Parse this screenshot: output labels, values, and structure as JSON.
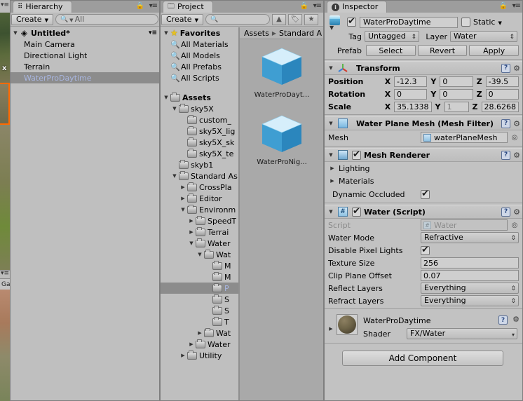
{
  "scene_sliver": {
    "tab_label": "Ga",
    "gizmo_label": "x"
  },
  "hierarchy": {
    "tab": "Hierarchy",
    "tab_icon": "hierarchy-icon",
    "create_label": "Create",
    "search_placeholder": "All",
    "scene_name": "Untitled*",
    "items": [
      {
        "label": "Main Camera",
        "selected": false
      },
      {
        "label": "Directional Light",
        "selected": false
      },
      {
        "label": "Terrain",
        "selected": false
      },
      {
        "label": "WaterProDaytime",
        "selected": true
      }
    ]
  },
  "project": {
    "tab": "Project",
    "tab_icon": "folder-icon",
    "create_label": "Create",
    "search_placeholder": "",
    "toolbar_icons": [
      "filter-by-type-icon",
      "filter-by-label-icon",
      "favorite-star-icon"
    ],
    "breadcrumb": [
      "Assets",
      "Standard A"
    ],
    "favorites_label": "Favorites",
    "favorites": [
      "All Materials",
      "All Models",
      "All Prefabs",
      "All Scripts"
    ],
    "tree": [
      {
        "label": "Assets",
        "depth": 0,
        "arrow": "down",
        "bold": true,
        "selected": false
      },
      {
        "label": "sky5X",
        "depth": 1,
        "arrow": "down",
        "bold": false,
        "selected": false
      },
      {
        "label": "custom_",
        "depth": 2,
        "arrow": "none",
        "bold": false,
        "selected": false
      },
      {
        "label": "sky5X_lig",
        "depth": 2,
        "arrow": "none",
        "bold": false,
        "selected": false
      },
      {
        "label": "sky5X_sk",
        "depth": 2,
        "arrow": "none",
        "bold": false,
        "selected": false
      },
      {
        "label": "sky5X_te",
        "depth": 2,
        "arrow": "none",
        "bold": false,
        "selected": false
      },
      {
        "label": "skyb1",
        "depth": 1,
        "arrow": "none",
        "bold": false,
        "selected": false
      },
      {
        "label": "Standard As",
        "depth": 1,
        "arrow": "down",
        "bold": false,
        "selected": false
      },
      {
        "label": "CrossPla",
        "depth": 2,
        "arrow": "right",
        "bold": false,
        "selected": false
      },
      {
        "label": "Editor",
        "depth": 2,
        "arrow": "right",
        "bold": false,
        "selected": false
      },
      {
        "label": "Environm",
        "depth": 2,
        "arrow": "down",
        "bold": false,
        "selected": false
      },
      {
        "label": "SpeedT",
        "depth": 3,
        "arrow": "right",
        "bold": false,
        "selected": false
      },
      {
        "label": "Terrai",
        "depth": 3,
        "arrow": "right",
        "bold": false,
        "selected": false
      },
      {
        "label": "Water",
        "depth": 3,
        "arrow": "down",
        "bold": false,
        "selected": false
      },
      {
        "label": "Wat",
        "depth": 4,
        "arrow": "down",
        "bold": false,
        "selected": false
      },
      {
        "label": "M",
        "depth": 5,
        "arrow": "none",
        "bold": false,
        "selected": false
      },
      {
        "label": "M",
        "depth": 5,
        "arrow": "none",
        "bold": false,
        "selected": false
      },
      {
        "label": "P",
        "depth": 5,
        "arrow": "none",
        "bold": false,
        "selected": true
      },
      {
        "label": "S",
        "depth": 5,
        "arrow": "none",
        "bold": false,
        "selected": false
      },
      {
        "label": "S",
        "depth": 5,
        "arrow": "none",
        "bold": false,
        "selected": false
      },
      {
        "label": "T",
        "depth": 5,
        "arrow": "none",
        "bold": false,
        "selected": false
      },
      {
        "label": "Wat",
        "depth": 4,
        "arrow": "right",
        "bold": false,
        "selected": false
      },
      {
        "label": "Water",
        "depth": 3,
        "arrow": "right",
        "bold": false,
        "selected": false
      },
      {
        "label": "Utility",
        "depth": 2,
        "arrow": "right",
        "bold": false,
        "selected": false
      }
    ],
    "assets": [
      {
        "label": "WaterProDayt...",
        "icon": "prefab-cube-icon"
      },
      {
        "label": "WaterProNig...",
        "icon": "prefab-cube-icon"
      }
    ]
  },
  "inspector": {
    "tab": "Inspector",
    "tab_icon": "info-icon",
    "object_name": "WaterProDaytime",
    "enabled": true,
    "static_label": "Static",
    "static_checked": false,
    "tag_label": "Tag",
    "tag_value": "Untagged",
    "layer_label": "Layer",
    "layer_value": "Water",
    "prefab_label": "Prefab",
    "prefab_buttons": [
      "Select",
      "Revert",
      "Apply"
    ],
    "transform": {
      "title": "Transform",
      "icon": "transform-axis-icon",
      "rows": [
        {
          "label": "Position",
          "x": "-12.3",
          "y": "0",
          "z": "-39.5",
          "ydim": false
        },
        {
          "label": "Rotation",
          "x": "0",
          "y": "0",
          "z": "0",
          "ydim": false
        },
        {
          "label": "Scale",
          "x": "35.1338",
          "y": "1",
          "z": "28.6268",
          "ydim": true
        }
      ],
      "axis_labels": [
        "X",
        "Y",
        "Z"
      ]
    },
    "mesh_filter": {
      "title": "Water Plane Mesh (Mesh Filter)",
      "icon": "mesh-filter-icon",
      "mesh_label": "Mesh",
      "mesh_value": "waterPlaneMesh"
    },
    "mesh_renderer": {
      "title": "Mesh Renderer",
      "icon": "mesh-renderer-icon",
      "enabled": true,
      "sections": [
        "Lighting",
        "Materials"
      ],
      "dynamic_occluded_label": "Dynamic Occluded",
      "dynamic_occluded_checked": true
    },
    "water_script": {
      "title": "Water (Script)",
      "icon": "csharp-script-icon",
      "enabled": true,
      "fields": [
        {
          "label": "Script",
          "type": "object",
          "value": "Water",
          "dim": true
        },
        {
          "label": "Water Mode",
          "type": "dropdown",
          "value": "Refractive"
        },
        {
          "label": "Disable Pixel Lights",
          "type": "checkbox",
          "value": true
        },
        {
          "label": "Texture Size",
          "type": "text",
          "value": "256"
        },
        {
          "label": "Clip Plane Offset",
          "type": "text",
          "value": "0.07"
        },
        {
          "label": "Reflect Layers",
          "type": "dropdown",
          "value": "Everything"
        },
        {
          "label": "Refract Layers",
          "type": "dropdown",
          "value": "Everything"
        }
      ]
    },
    "material": {
      "name": "WaterProDaytime",
      "shader_label": "Shader",
      "shader_value": "FX/Water",
      "thumb_icon": "material-preview-icon"
    },
    "add_component_label": "Add Component"
  },
  "colors": {
    "panel_bg": "#bfbfbf",
    "selection_bg": "#8c8c8c",
    "selection_text": "#a9b6e0",
    "prefab_blue": "#4fa8dd",
    "highlight_orange": "#ff6a00"
  }
}
